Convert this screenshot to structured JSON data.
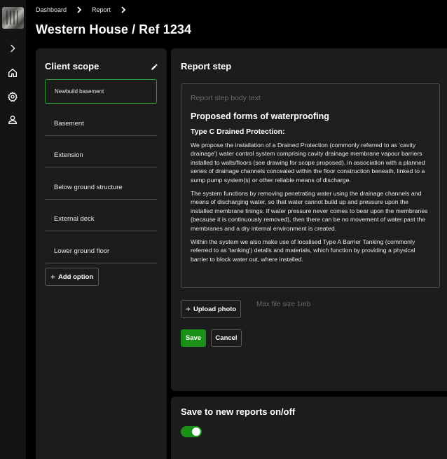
{
  "nav": {
    "icons": [
      "chevron-right-icon",
      "home-icon",
      "gear-icon",
      "user-icon"
    ]
  },
  "breadcrumb": {
    "items": [
      "Dashboard",
      "Report"
    ]
  },
  "page": {
    "title": "Western House / Ref 1234"
  },
  "scope": {
    "heading": "Client scope",
    "options": [
      "Newbuild basement",
      "Basement",
      "Extension",
      "Below ground structure",
      "External deck",
      "Lower ground floor"
    ],
    "selected_index": 0,
    "add_label": "Add option"
  },
  "step": {
    "heading": "Report step",
    "placeholder": "Report step body text",
    "body_title": "Proposed forms of waterproofing",
    "body_subtitle": "Type C Drained Protection:",
    "paragraphs": [
      "We propose the installation of a Drained Protection (commonly referred to as 'cavity drainage') water control system comprising cavity drainage membrane vapour barriers installed to walls/floors (see drawing for scope proposed), in association with a planned series of drainage channels concealed within the floor construction beneath, linked to a sump pump system(s) or other reliable means of discharge.",
      "The system functions by removing penetrating water using the drainage channels and means of discharging water, so that water cannot build up and pressure upon the installed membrane linings.  If water pressure never comes to bear upon the membranes (because it is continuously removed), then there can be no movement of water past the membranes and a dry internal environment is created.",
      "Within the system we also make use of localised Type A Barrier Tanking (commonly referred to as 'tanking') details and materials, which function by providing a physical barrier to block water out, where installed."
    ],
    "upload_label": "Upload photo",
    "max_size": "Max file size 1mb",
    "save_label": "Save",
    "cancel_label": "Cancel"
  },
  "toggle": {
    "heading": "Save to new reports on/off",
    "state": "on"
  },
  "colors": {
    "accent": "#1a8f1a",
    "panel": "#1c1c1c",
    "background": "#000000"
  }
}
